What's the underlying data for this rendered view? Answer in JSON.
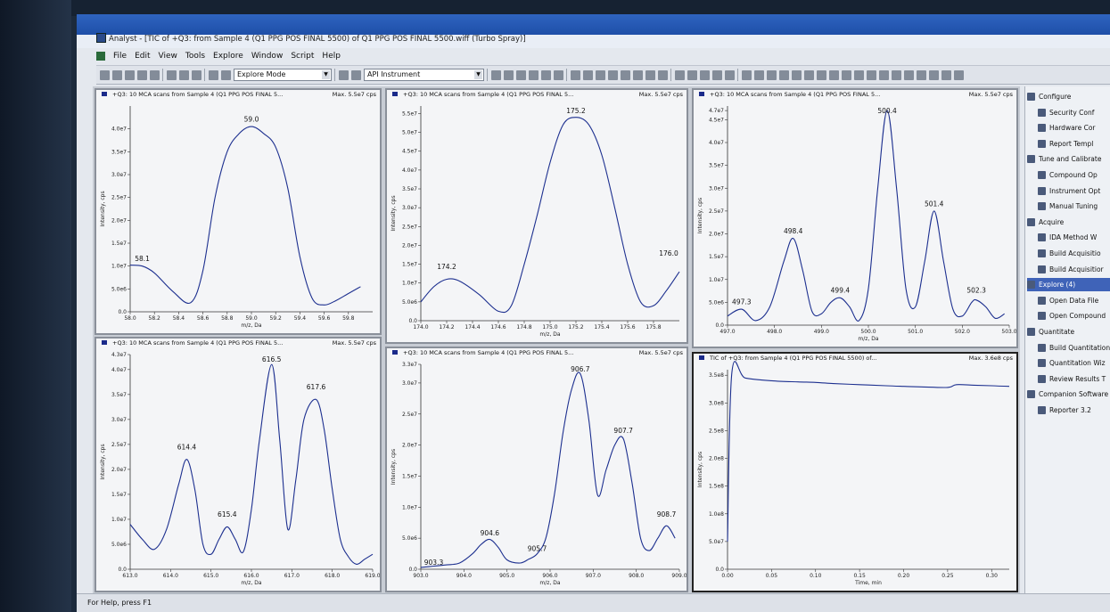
{
  "window": {
    "title": "Analyst - [TIC of +Q3: from Sample 4 (Q1 PPG POS FINAL 5500) of Q1 PPG POS FINAL 5500.wiff (Turbo Spray)]"
  },
  "menu": [
    "File",
    "Edit",
    "View",
    "Tools",
    "Explore",
    "Window",
    "Script",
    "Help"
  ],
  "toolbar": {
    "mode_select": "Explore Mode",
    "instrument_select": "API Instrument"
  },
  "sidebar": {
    "items": [
      {
        "label": "Configure",
        "level": 0
      },
      {
        "label": "Security Conf",
        "level": 1
      },
      {
        "label": "Hardware Cor",
        "level": 1
      },
      {
        "label": "Report Templ",
        "level": 1
      },
      {
        "label": "Tune and Calibrate",
        "level": 0
      },
      {
        "label": "Compound Op",
        "level": 1
      },
      {
        "label": "Instrument Opt",
        "level": 1
      },
      {
        "label": "Manual Tuning",
        "level": 1
      },
      {
        "label": "Acquire",
        "level": 0
      },
      {
        "label": "IDA Method W",
        "level": 1
      },
      {
        "label": "Build Acquisitio",
        "level": 1
      },
      {
        "label": "Build Acquisitior",
        "level": 1
      },
      {
        "label": "Explore (4)",
        "level": 0,
        "selected": true
      },
      {
        "label": "Open Data File",
        "level": 1
      },
      {
        "label": "Open Compound",
        "level": 1
      },
      {
        "label": "Quantitate",
        "level": 0
      },
      {
        "label": "Build Quantitation",
        "level": 1
      },
      {
        "label": "Quantitation Wiz",
        "level": 1
      },
      {
        "label": "Review Results T",
        "level": 1
      },
      {
        "label": "Companion Software",
        "level": 0
      },
      {
        "label": "Reporter 3.2",
        "level": 1
      }
    ]
  },
  "status": {
    "help_text": "For Help, press F1"
  },
  "panes": [
    {
      "header": "+Q3: 10 MCA scans from Sample 4 (Q1 PPG POS FINAL 5...",
      "max_label": "Max. 5.5e7 cps",
      "xlabel": "m/z, Da",
      "ylabel": "Intensity, cps",
      "chart_data": {
        "type": "line",
        "xlim": [
          58.0,
          60.0
        ],
        "ylim": [
          0,
          45000000
        ],
        "x_ticks": [
          "58.0",
          "58.2",
          "58.4",
          "58.6",
          "58.8",
          "59.0",
          "59.2",
          "59.4",
          "59.6",
          "59.8"
        ],
        "y_ticks": [
          "0.0",
          "5.0e6",
          "1.0e7",
          "1.5e7",
          "2.0e7",
          "2.5e7",
          "3.0e7",
          "3.5e7",
          "4.0e7"
        ],
        "peak_labels": [
          {
            "x": 59.0,
            "y": 41000000,
            "text": "59.0"
          },
          {
            "x": 58.1,
            "y": 10500000,
            "text": "58.1"
          }
        ],
        "x": [
          58.0,
          58.1,
          58.2,
          58.35,
          58.5,
          58.6,
          58.7,
          58.8,
          58.9,
          59.0,
          59.1,
          59.2,
          59.3,
          59.4,
          59.5,
          59.6,
          59.7,
          59.8,
          59.9
        ],
        "y": [
          10200000,
          10000000,
          8500000,
          4500000,
          2000000,
          9000000,
          25000000,
          35000000,
          39000000,
          40500000,
          39000000,
          36000000,
          27000000,
          12000000,
          3000000,
          1500000,
          2500000,
          4000000,
          5500000
        ]
      }
    },
    {
      "header": "+Q3: 10 MCA scans from Sample 4 (Q1 PPG POS FINAL 5...",
      "max_label": "Max. 5.5e7 cps",
      "xlabel": "m/z, Da",
      "ylabel": "Intensity, cps",
      "chart_data": {
        "type": "line",
        "xlim": [
          174.0,
          176.0
        ],
        "ylim": [
          0,
          57000000
        ],
        "x_ticks": [
          "174.0",
          "174.2",
          "174.4",
          "174.6",
          "174.8",
          "175.0",
          "175.2",
          "175.4",
          "175.6",
          "175.8"
        ],
        "y_ticks": [
          "0.0",
          "5.0e6",
          "1.0e7",
          "1.5e7",
          "2.0e7",
          "2.5e7",
          "3.0e7",
          "3.5e7",
          "4.0e7",
          "4.5e7",
          "5.0e7",
          "5.5e7"
        ],
        "peak_labels": [
          {
            "x": 175.2,
            "y": 55500000,
            "text": "175.2"
          },
          {
            "x": 174.2,
            "y": 13000000,
            "text": "174.2"
          },
          {
            "x": 176.0,
            "y": 16500000,
            "text": "176.0"
          }
        ],
        "x": [
          174.0,
          174.1,
          174.2,
          174.3,
          174.45,
          174.6,
          174.7,
          174.8,
          174.9,
          175.0,
          175.1,
          175.2,
          175.3,
          175.4,
          175.5,
          175.6,
          175.7,
          175.8,
          175.9,
          176.0
        ],
        "y": [
          5000000,
          9000000,
          11000000,
          10500000,
          7000000,
          2500000,
          4000000,
          15000000,
          28000000,
          42000000,
          52000000,
          54000000,
          52000000,
          44000000,
          30000000,
          15000000,
          5000000,
          4000000,
          8000000,
          13000000
        ]
      }
    },
    {
      "header": "+Q3: 10 MCA scans from Sample 4 (Q1 PPG POS FINAL 5...",
      "max_label": "Max. 5.5e7 cps",
      "xlabel": "m/z, Da",
      "ylabel": "Intensity, cps",
      "chart_data": {
        "type": "line",
        "xlim": [
          497.0,
          503.0
        ],
        "ylim": [
          0,
          48000000
        ],
        "x_ticks": [
          "497.0",
          "498.0",
          "499.0",
          "500.0",
          "501.0",
          "502.0",
          "503.0"
        ],
        "y_ticks": [
          "0.0",
          "5.0e6",
          "1.0e7",
          "1.5e7",
          "2.0e7",
          "2.5e7",
          "3.0e7",
          "3.5e7",
          "4.0e7",
          "4.5e7",
          "4.7e7"
        ],
        "peak_labels": [
          {
            "x": 500.4,
            "y": 47500000,
            "text": "500.4"
          },
          {
            "x": 498.4,
            "y": 19500000,
            "text": "498.4"
          },
          {
            "x": 501.4,
            "y": 25500000,
            "text": "501.4"
          },
          {
            "x": 499.4,
            "y": 6500000,
            "text": "499.4"
          },
          {
            "x": 502.3,
            "y": 6500000,
            "text": "502.3"
          },
          {
            "x": 497.3,
            "y": 4000000,
            "text": "497.3"
          }
        ],
        "x": [
          497.0,
          497.3,
          497.6,
          497.9,
          498.2,
          498.4,
          498.6,
          498.8,
          499.0,
          499.2,
          499.4,
          499.6,
          499.8,
          500.0,
          500.2,
          500.4,
          500.6,
          500.8,
          501.0,
          501.2,
          501.4,
          501.6,
          501.8,
          502.0,
          502.2,
          502.3,
          502.5,
          502.7,
          502.9
        ],
        "y": [
          2000000,
          3500000,
          1000000,
          4000000,
          14000000,
          19000000,
          12000000,
          3000000,
          2500000,
          5000000,
          6000000,
          4000000,
          1000000,
          8000000,
          30000000,
          47000000,
          30000000,
          8000000,
          4000000,
          14000000,
          25000000,
          14000000,
          3500000,
          2000000,
          5000000,
          5500000,
          4000000,
          1500000,
          2500000
        ]
      }
    },
    {
      "header": "+Q3: 10 MCA scans from Sample 4 (Q1 PPG POS FINAL 5...",
      "max_label": "Max. 5.5e7 cps",
      "xlabel": "m/z, Da",
      "ylabel": "Intensity, cps",
      "chart_data": {
        "type": "line",
        "xlim": [
          613.0,
          619.0
        ],
        "ylim": [
          0,
          43000000
        ],
        "x_ticks": [
          "613.0",
          "614.0",
          "615.0",
          "616.0",
          "617.0",
          "618.0",
          "619.0"
        ],
        "y_ticks": [
          "0.0",
          "5.0e6",
          "1.0e7",
          "1.5e7",
          "2.0e7",
          "2.5e7",
          "3.0e7",
          "3.5e7",
          "4.0e7",
          "4.3e7"
        ],
        "peak_labels": [
          {
            "x": 616.5,
            "y": 42500000,
            "text": "616.5"
          },
          {
            "x": 617.6,
            "y": 35500000,
            "text": "617.6"
          },
          {
            "x": 614.4,
            "y": 23500000,
            "text": "614.4"
          },
          {
            "x": 615.4,
            "y": 10000000,
            "text": "615.4"
          }
        ],
        "x": [
          613.0,
          613.3,
          613.6,
          613.9,
          614.2,
          614.4,
          614.6,
          614.8,
          615.0,
          615.2,
          615.4,
          615.6,
          615.8,
          616.0,
          616.2,
          616.5,
          616.7,
          616.9,
          617.1,
          617.3,
          617.6,
          617.8,
          618.0,
          618.2,
          618.4,
          618.6,
          618.8,
          619.0
        ],
        "y": [
          9000000,
          6000000,
          4000000,
          8000000,
          17000000,
          22000000,
          16000000,
          5000000,
          3000000,
          6000000,
          8500000,
          6000000,
          3500000,
          12000000,
          26000000,
          41000000,
          26000000,
          8000000,
          18000000,
          30000000,
          34000000,
          28000000,
          16000000,
          6000000,
          2500000,
          1000000,
          2000000,
          3000000
        ]
      }
    },
    {
      "header": "+Q3: 10 MCA scans from Sample 4 (Q1 PPG POS FINAL 5...",
      "max_label": "Max. 5.5e7 cps",
      "xlabel": "m/z, Da",
      "ylabel": "Intensity, cps",
      "chart_data": {
        "type": "line",
        "xlim": [
          903.0,
          909.0
        ],
        "ylim": [
          0,
          33000000
        ],
        "x_ticks": [
          "903.0",
          "904.0",
          "905.0",
          "906.0",
          "907.0",
          "908.0",
          "909.0"
        ],
        "y_ticks": [
          "0.0",
          "5.0e6",
          "1.0e7",
          "1.5e7",
          "2.0e7",
          "2.5e7",
          "3.0e7",
          "3.3e7"
        ],
        "peak_labels": [
          {
            "x": 906.7,
            "y": 32500000,
            "text": "906.7"
          },
          {
            "x": 907.7,
            "y": 21500000,
            "text": "907.7"
          },
          {
            "x": 908.7,
            "y": 8000000,
            "text": "908.7"
          },
          {
            "x": 904.6,
            "y": 5000000,
            "text": "904.6"
          },
          {
            "x": 905.7,
            "y": 2500000,
            "text": "905.7"
          },
          {
            "x": 903.3,
            "y": 300000,
            "text": "903.3"
          }
        ],
        "x": [
          903.0,
          903.3,
          903.6,
          903.9,
          904.2,
          904.4,
          904.6,
          904.8,
          905.0,
          905.3,
          905.5,
          905.7,
          905.9,
          906.1,
          906.3,
          906.5,
          906.7,
          906.9,
          907.1,
          907.3,
          907.5,
          907.7,
          907.9,
          908.1,
          908.3,
          908.5,
          908.7,
          908.9
        ],
        "y": [
          300000,
          500000,
          700000,
          1000000,
          2500000,
          4000000,
          4800000,
          3500000,
          1500000,
          1000000,
          1600000,
          2500000,
          5000000,
          12000000,
          22000000,
          29000000,
          31500000,
          24000000,
          12000000,
          16000000,
          20000000,
          21000000,
          14000000,
          5000000,
          3000000,
          5000000,
          7000000,
          5000000
        ]
      }
    },
    {
      "header": "TIC of +Q3: from Sample 4 (Q1 PPG POS FINAL 5500) of...",
      "max_label": "Max. 3.6e8 cps",
      "xlabel": "Time, min",
      "ylabel": "Intensity, cps",
      "chart_data": {
        "type": "line",
        "xlim": [
          0.0,
          0.32
        ],
        "ylim": [
          0,
          360000000
        ],
        "x_ticks": [
          "0.00",
          "0.05",
          "0.10",
          "0.15",
          "0.20",
          "0.25",
          "0.30"
        ],
        "y_ticks": [
          "0.0",
          "5.0e7",
          "1.0e8",
          "1.5e8",
          "2.0e8",
          "2.5e8",
          "3.0e8",
          "3.5e8"
        ],
        "peak_labels": [],
        "x": [
          0.0,
          0.005,
          0.02,
          0.05,
          0.08,
          0.1,
          0.12,
          0.15,
          0.18,
          0.2,
          0.22,
          0.25,
          0.26,
          0.28,
          0.3,
          0.32
        ],
        "y": [
          50000000,
          355000000,
          345000000,
          340000000,
          338000000,
          337000000,
          335000000,
          333000000,
          331000000,
          330000000,
          329000000,
          328000000,
          333000000,
          332000000,
          331000000,
          330000000
        ]
      }
    }
  ]
}
